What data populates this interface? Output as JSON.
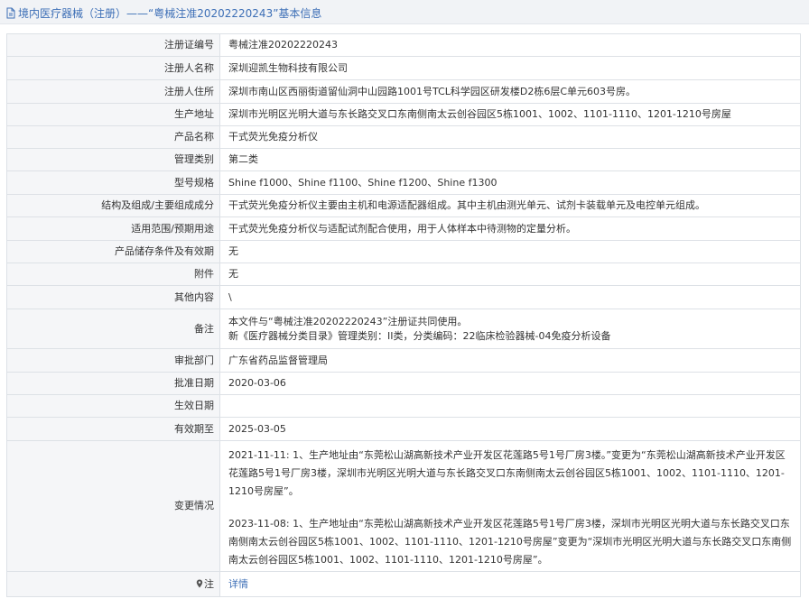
{
  "header": {
    "title": "境内医疗器械（注册）——“粤械注准20202220243”基本信息"
  },
  "rows": [
    {
      "label": "注册证编号",
      "value": "粤械注准20202220243"
    },
    {
      "label": "注册人名称",
      "value": "深圳迎凯生物科技有限公司"
    },
    {
      "label": "注册人住所",
      "value": "深圳市南山区西丽街道留仙洞中山园路1001号TCL科学园区研发楼D2栋6层C单元603号房。"
    },
    {
      "label": "生产地址",
      "value": "深圳市光明区光明大道与东长路交叉口东南侧南太云创谷园区5栋1001、1002、1101-1110、1201-1210号房屋"
    },
    {
      "label": "产品名称",
      "value": "干式荧光免疫分析仪"
    },
    {
      "label": "管理类别",
      "value": "第二类"
    },
    {
      "label": "型号规格",
      "value": "Shine f1000、Shine f1100、Shine f1200、Shine f1300"
    },
    {
      "label": "结构及组成/主要组成成分",
      "value": "干式荧光免疫分析仪主要由主机和电源适配器组成。其中主机由测光单元、试剂卡装载单元及电控单元组成。"
    },
    {
      "label": "适用范围/预期用途",
      "value": "干式荧光免疫分析仪与适配试剂配合使用，用于人体样本中待测物的定量分析。"
    },
    {
      "label": "产品储存条件及有效期",
      "value": "无"
    },
    {
      "label": "附件",
      "value": "无"
    },
    {
      "label": "其他内容",
      "value": "\\"
    },
    {
      "label": "备注",
      "line1": "本文件与“粤械注准20202220243”注册证共同使用。",
      "line2": "新《医疗器械分类目录》管理类别：II类，分类编码：22临床检验器械-04免疫分析设备"
    },
    {
      "label": "审批部门",
      "value": "广东省药品监督管理局"
    },
    {
      "label": "批准日期",
      "value": "2020-03-06"
    },
    {
      "label": "生效日期",
      "value": ""
    },
    {
      "label": "有效期至",
      "value": "2025-03-05"
    },
    {
      "label": "变更情况",
      "entry1": "2021-11-11: 1、生产地址由“东莞松山湖高新技术产业开发区花莲路5号1号厂房3楼。”变更为“东莞松山湖高新技术产业开发区花莲路5号1号厂房3楼，深圳市光明区光明大道与东长路交叉口东南侧南太云创谷园区5栋1001、1002、1101-1110、1201-1210号房屋”。",
      "entry2": "2023-11-08: 1、生产地址由“东莞松山湖高新技术产业开发区花莲路5号1号厂房3楼，深圳市光明区光明大道与东长路交叉口东南侧南太云创谷园区5栋1001、1002、1101-1110、1201-1210号房屋”变更为“深圳市光明区光明大道与东长路交叉口东南侧南太云创谷园区5栋1001、1002、1101-1110、1201-1210号房屋”。"
    },
    {
      "label": "注",
      "link": "详情",
      "icon": "location-pin-icon"
    }
  ],
  "colors": {
    "accent": "#3d6fb6",
    "label_bg": "#f5f6f8",
    "border": "#dde1e6",
    "header_bg": "#f1f3f6"
  }
}
